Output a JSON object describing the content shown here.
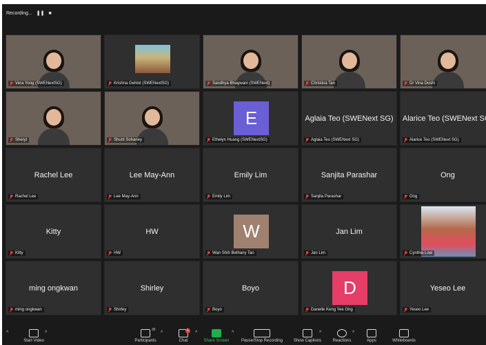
{
  "recording": {
    "label": "Recording...",
    "pause": "❚❚",
    "stop": "■"
  },
  "participants": [
    {
      "name": "Vera Yong (SWENextSG)",
      "kind": "video",
      "scene": "scene-1"
    },
    {
      "name": "Krishna Gehlot (SWENextSG)",
      "kind": "thumb"
    },
    {
      "name": "Sandhya Bhagwani (SWENext)",
      "kind": "video",
      "scene": "scene-3"
    },
    {
      "name": "Christina Tan",
      "kind": "video",
      "scene": "scene-4"
    },
    {
      "name": "Dr Vina Doshi",
      "kind": "video",
      "scene": "scene-5"
    },
    {
      "name": "Sheryl",
      "kind": "video",
      "scene": "scene-6"
    },
    {
      "name": "Shurti Sohaney",
      "kind": "video",
      "scene": "scene-7"
    },
    {
      "name": "Ethelyn Huang (SWENextSG)",
      "kind": "avatar",
      "initial": "E",
      "color": "#6b5fd6"
    },
    {
      "name": "Aglaia Teo (SWENext SG)",
      "kind": "name"
    },
    {
      "name": "Alarice Teo (SWENext SG)",
      "kind": "name"
    },
    {
      "name": "Rachel Lee",
      "kind": "name"
    },
    {
      "name": "Lee May-Ann",
      "kind": "name"
    },
    {
      "name": "Emily Lim",
      "kind": "name"
    },
    {
      "name": "Sanjita Parashar",
      "kind": "name"
    },
    {
      "name": "Ong",
      "kind": "name"
    },
    {
      "name": "Kitty",
      "kind": "name"
    },
    {
      "name": "HW",
      "kind": "name"
    },
    {
      "name": "Wan Shih Bethany Tan",
      "kind": "avatar",
      "initial": "W",
      "color": "#a08170"
    },
    {
      "name": "Jan Lim",
      "kind": "name"
    },
    {
      "name": "Cynthia Low",
      "kind": "thumb2"
    },
    {
      "name": "ming ongkwan",
      "kind": "name"
    },
    {
      "name": "Shirley",
      "kind": "name"
    },
    {
      "name": "Boyo",
      "kind": "name"
    },
    {
      "name": "Danelle Keng Yee Ong",
      "kind": "avatar",
      "initial": "D",
      "color": "#e53e68"
    },
    {
      "name": "Yeseo Lee",
      "kind": "name"
    }
  ],
  "toolbar": {
    "start_video": "Start Video",
    "participants": "Participants",
    "participants_count": "36",
    "chat": "Chat",
    "chat_badge": "1",
    "share_screen": "Share Screen",
    "pause_stop_recording": "Pause/Stop Recording",
    "show_captions": "Show Captions",
    "reactions": "Reactions",
    "apps": "Apps",
    "whiteboards": "Whiteboards"
  },
  "colors": {
    "accent_share": "#1eb04c",
    "muted_mic": "#e04343",
    "tile_bg": "#2f2f2f"
  }
}
